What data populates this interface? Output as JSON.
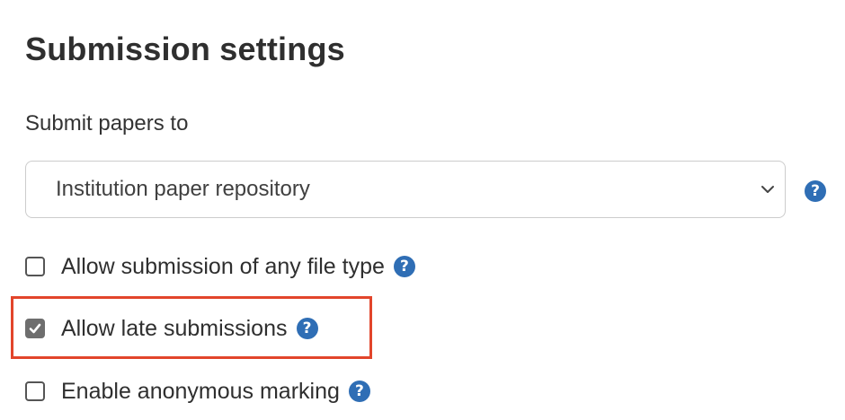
{
  "section": {
    "title": "Submission settings"
  },
  "submit_to": {
    "label": "Submit papers to",
    "selected_value": "Institution paper repository",
    "help_icon": "question-circle-icon"
  },
  "options": [
    {
      "label": "Allow submission of any file type",
      "checked": false,
      "help_icon": "question-circle-icon"
    },
    {
      "label": "Allow late submissions",
      "checked": true,
      "help_icon": "question-circle-icon"
    },
    {
      "label": "Enable anonymous marking",
      "checked": false,
      "help_icon": "question-circle-icon"
    }
  ],
  "help_glyph": "?",
  "colors": {
    "help_icon": "#2f6eb5",
    "highlight": "#e2452b",
    "checked_box": "#6e6e6e"
  }
}
